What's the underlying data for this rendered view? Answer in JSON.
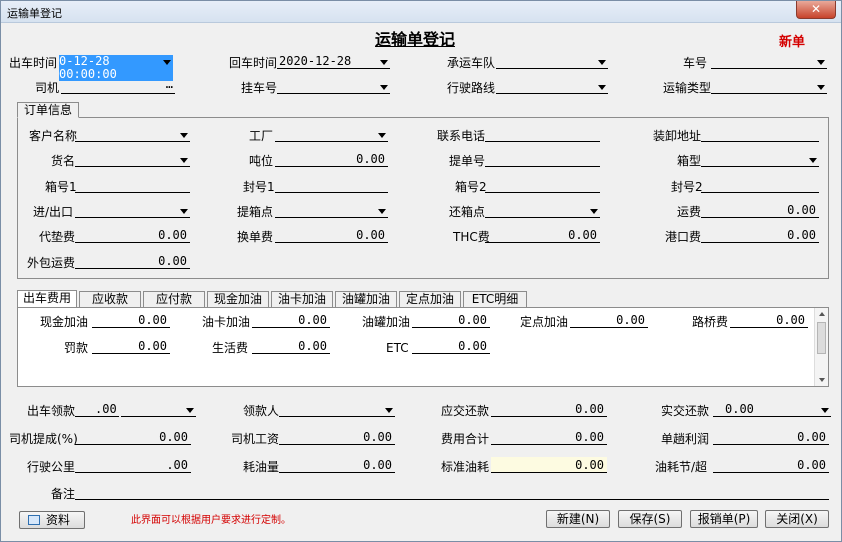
{
  "window": {
    "title": "运输单登记",
    "close_glyph": "✕"
  },
  "header": {
    "title": "运输单登记",
    "badge": "新单",
    "badge_color": "#d40000"
  },
  "row1": {
    "depart_label": "出车时间",
    "depart_value": "0-12-28 00:00:00",
    "return_label": "回车时间",
    "return_value": "2020-12-28",
    "fleet_label": "承运车队",
    "plate_label": "车号"
  },
  "row2": {
    "driver_label": "司机",
    "driver_btn": "…",
    "trailer_label": "挂车号",
    "route_label": "行驶路线",
    "type_label": "运输类型"
  },
  "order": {
    "legend": "订单信息",
    "customer_label": "客户名称",
    "factory_label": "工厂",
    "phone_label": "联系电话",
    "address_label": "装卸地址",
    "goods_label": "货名",
    "tonnage_label": "吨位",
    "tonnage_value": "0.00",
    "bill_label": "提单号",
    "boxtype_label": "箱型",
    "box1_label": "箱号1",
    "seal1_label": "封号1",
    "box2_label": "箱号2",
    "seal2_label": "封号2",
    "io_label": "进/出口",
    "pickup_label": "提箱点",
    "return_pt_label": "还箱点",
    "freight_label": "运费",
    "freight_value": "0.00",
    "advance_label": "代垫费",
    "advance_value": "0.00",
    "exchange_label": "换单费",
    "exchange_value": "0.00",
    "thc_label": "THC费",
    "thc_value": "0.00",
    "port_label": "港口费",
    "port_value": "0.00",
    "outsource_label": "外包运费",
    "outsource_value": "0.00"
  },
  "tabs": [
    "出车费用",
    "应收款",
    "应付款",
    "现金加油",
    "油卡加油",
    "油罐加油",
    "定点加油",
    "ETC明细"
  ],
  "expense": {
    "cash_fuel_label": "现金加油",
    "cash_fuel_value": "0.00",
    "card_fuel_label": "油卡加油",
    "card_fuel_value": "0.00",
    "tank_fuel_label": "油罐加油",
    "tank_fuel_value": "0.00",
    "fixed_fuel_label": "定点加油",
    "fixed_fuel_value": "0.00",
    "toll_label": "路桥费",
    "toll_value": "0.00",
    "fine_label": "罚款",
    "fine_value": "0.00",
    "living_label": "生活费",
    "living_value": "0.00",
    "etc_label": "ETC",
    "etc_value": "0.00"
  },
  "summary": {
    "draw_label": "出车领款",
    "draw_value": ".00",
    "receiver_label": "领款人",
    "due_label": "应交还款",
    "due_value": "0.00",
    "actual_label": "实交还款",
    "actual_value": "0.00",
    "commission_label": "司机提成(%)",
    "commission_value": "0.00",
    "wage_label": "司机工资",
    "wage_value": "0.00",
    "total_label": "费用合计",
    "total_value": "0.00",
    "profit_label": "单趟利润",
    "profit_value": "0.00",
    "km_label": "行驶公里",
    "km_value": ".00",
    "fuel_label": "耗油量",
    "fuel_value": "0.00",
    "std_fuel_label": "标准油耗",
    "std_fuel_value": "0.00",
    "saving_label": "油耗节/超",
    "saving_value": "0.00",
    "note_label": "备注"
  },
  "footer": {
    "data_btn": "资料",
    "hint": "此界面可以根据用户要求进行定制。",
    "hint_color": "#d40000",
    "new_btn": "新建(N)",
    "save_btn": "保存(S)",
    "report_btn": "报销单(P)",
    "close_btn": "关闭(X)"
  }
}
